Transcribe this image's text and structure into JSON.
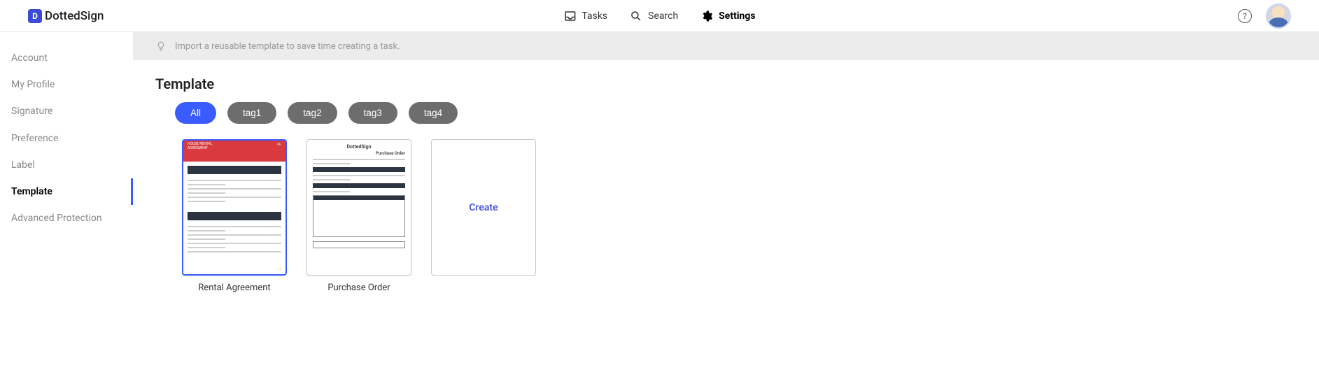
{
  "brand": {
    "name": "DottedSign"
  },
  "header": {
    "tasks": "Tasks",
    "search": "Search",
    "settings": "Settings"
  },
  "sidebar": {
    "items": [
      {
        "label": "Account"
      },
      {
        "label": "My Profile"
      },
      {
        "label": "Signature"
      },
      {
        "label": "Preference"
      },
      {
        "label": "Label"
      },
      {
        "label": "Template"
      },
      {
        "label": "Advanced Protection"
      }
    ]
  },
  "info_tip": "Import a reusable template to save time creating a task.",
  "page_title": "Template",
  "tags": [
    "All",
    "tag1",
    "tag2",
    "tag3",
    "tag4"
  ],
  "templates": [
    {
      "name": "Rental Agreement"
    },
    {
      "name": "Purchase Order"
    }
  ],
  "create_label": "Create",
  "preview": {
    "rental_heading": "HOUSE RENTAL AGREEMENT",
    "po_brand": "DottedSign",
    "po_title": "Purchase Order"
  }
}
